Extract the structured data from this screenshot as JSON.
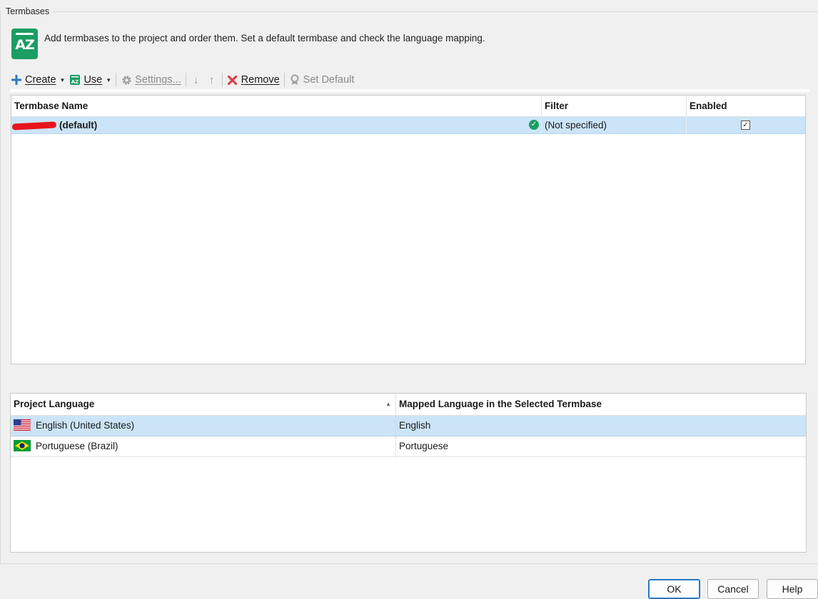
{
  "group": {
    "title": "Termbases"
  },
  "header": {
    "icon_text": "AZ",
    "description": "Add termbases to the project and order them. Set a default termbase and check the language mapping."
  },
  "toolbar": {
    "create_label": "Create",
    "use_label": "Use",
    "settings_label": "Settings...",
    "move_down": "↓",
    "move_up": "↑",
    "remove_label": "Remove",
    "set_default_label": "Set Default"
  },
  "termbase_grid": {
    "columns": [
      "Termbase Name",
      "Filter",
      "Enabled"
    ],
    "rows": [
      {
        "name": "(default)",
        "filter": "(Not specified)",
        "enabled": true,
        "check_mark": "✓",
        "status_mark": "✓"
      }
    ]
  },
  "language_grid": {
    "columns": [
      "Project Language",
      "Mapped Language in the Selected Termbase"
    ],
    "sort_indicator": "▲",
    "rows": [
      {
        "project_language": "English (United States)",
        "mapped_language": "English",
        "flag": "us-flag-icon"
      },
      {
        "project_language": "Portuguese (Brazil)",
        "mapped_language": "Portuguese",
        "flag": "brazil-flag-icon"
      }
    ]
  },
  "buttons": {
    "ok": "OK",
    "cancel": "Cancel",
    "help": "Help"
  },
  "colors": {
    "accent_green": "#1c9d62",
    "selection_blue": "#cce4f7",
    "remove_red": "#e0404a",
    "create_blue": "#2b78c5"
  }
}
